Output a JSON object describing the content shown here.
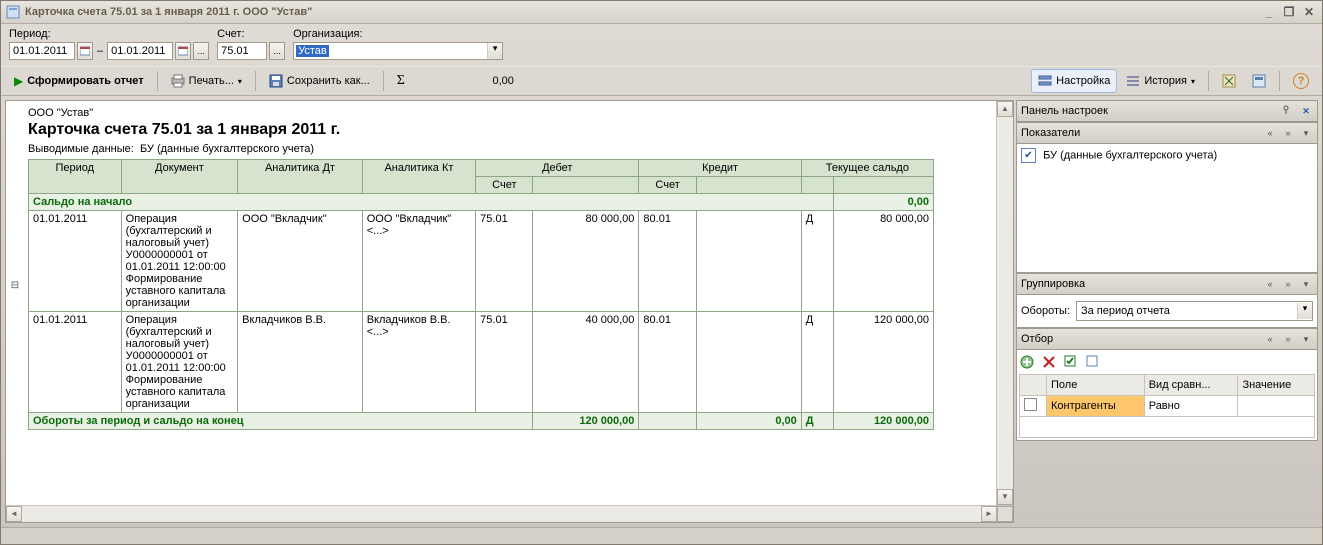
{
  "window": {
    "title": "Карточка счета 75.01 за 1 января 2011 г. ООО \"Устав\""
  },
  "filters": {
    "period_label": "Период:",
    "date_from": "01.01.2011",
    "date_to": "01.01.2011",
    "account_label": "Счет:",
    "account": "75.01",
    "org_label": "Организация:",
    "org": "Устав"
  },
  "toolbar": {
    "form_report": "Сформировать отчет",
    "print": "Печать...",
    "save_as": "Сохранить как...",
    "sigma": "Σ",
    "sum": "0,00",
    "settings": "Настройка",
    "history": "История"
  },
  "report": {
    "org_name": "ООО \"Устав\"",
    "title": "Карточка счета 75.01 за 1 января 2011 г.",
    "subinfo_label": "Выводимые данные:",
    "subinfo_value": "БУ (данные бухгалтерского учета)",
    "columns": {
      "period": "Период",
      "document": "Документ",
      "an_dt": "Аналитика Дт",
      "an_kt": "Аналитика Кт",
      "debit": "Дебет",
      "credit": "Кредит",
      "balance": "Текущее сальдо",
      "acc": "Счет"
    },
    "start_saldo": {
      "label": "Сальдо на начало",
      "amount": "0,00"
    },
    "rows": [
      {
        "date": "01.01.2011",
        "doc": "Операция (бухгалтерский и налоговый учет) У0000000001 от 01.01.2011 12:00:00 Формирование уставного капитала организации",
        "an_dt": "ООО \"Вкладчик\"",
        "an_kt": "ООО \"Вкладчик\"\n<...>",
        "dt_acc": "75.01",
        "dt_amt": "80 000,00",
        "kt_acc": "80.01",
        "kt_amt": "",
        "bal_dk": "Д",
        "bal_amt": "80 000,00"
      },
      {
        "date": "01.01.2011",
        "doc": "Операция (бухгалтерский и налоговый учет) У0000000001 от 01.01.2011 12:00:00 Формирование уставного капитала организации",
        "an_dt": "Вкладчиков В.В.",
        "an_kt": "Вкладчиков В.В.\n<...>",
        "dt_acc": "75.01",
        "dt_amt": "40 000,00",
        "kt_acc": "80.01",
        "kt_amt": "",
        "bal_dk": "Д",
        "bal_amt": "120 000,00"
      }
    ],
    "totals": {
      "label": "Обороты за период и сальдо на конец",
      "dt_amt": "120 000,00",
      "kt_amt": "0,00",
      "bal_dk": "Д",
      "bal_amt": "120 000,00"
    }
  },
  "settings_panel": {
    "panel_title": "Панель настроек",
    "indicators": {
      "title": "Показатели",
      "item1": "БУ (данные бухгалтерского учета)"
    },
    "grouping": {
      "title": "Группировка",
      "turnover_label": "Обороты:",
      "turnover_value": "За период отчета"
    },
    "selection": {
      "title": "Отбор",
      "col_field": "Поле",
      "col_compare": "Вид сравн...",
      "col_value": "Значение",
      "row_field": "Контрагенты",
      "row_compare": "Равно"
    }
  }
}
